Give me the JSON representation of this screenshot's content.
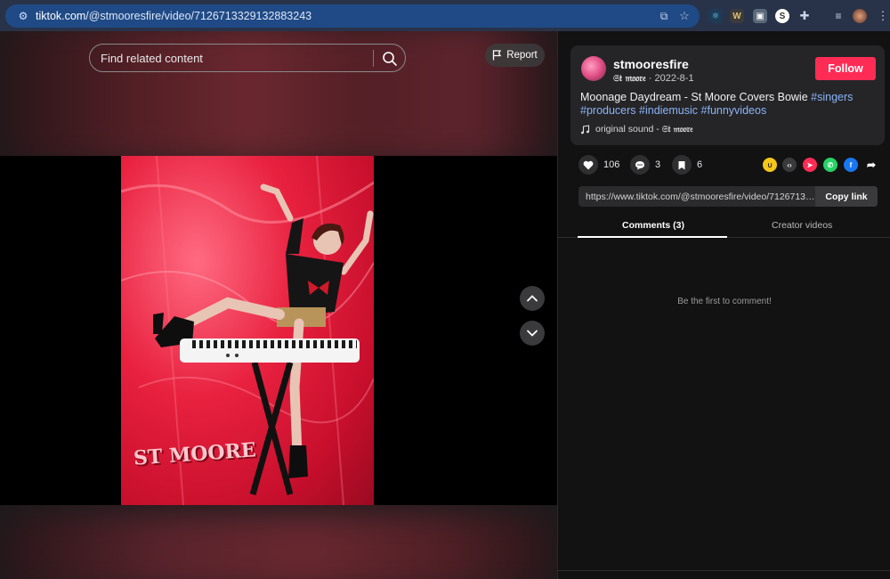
{
  "browser": {
    "url_host": "tiktok.com",
    "url_path": "/@stmooresfire/video/7126713329132883243"
  },
  "video": {
    "search_placeholder": "Find related content",
    "report_label": "Report",
    "watermark": "ST MOORE"
  },
  "post": {
    "username": "stmooresfire",
    "display_name": "𝔖𝔱 𝔪𝔬𝔬𝔯𝔢",
    "date": "2022-8-1",
    "follow_label": "Follow",
    "description": "Moonage Daydream - St Moore Covers Bowie",
    "hashtags": [
      "#singers",
      "#producers",
      "#indiemusic",
      "#funnyvideos"
    ],
    "sound_prefix": "original sound -",
    "sound_author": "𝔖𝔱 𝔪𝔬𝔬𝔯𝔢"
  },
  "stats": {
    "likes": "106",
    "comments": "3",
    "saves": "6"
  },
  "link": {
    "url": "https://www.tiktok.com/@stmooresfire/video/71267133...",
    "copy_label": "Copy link"
  },
  "tabs": {
    "comments": "Comments (3)",
    "creator_videos": "Creator videos"
  },
  "comments_empty": "Be the first to comment!",
  "colors": {
    "accent": "#fe2c55",
    "hashtag": "#8ab4f8",
    "panel_bg": "#121212",
    "card_bg": "#252527"
  }
}
